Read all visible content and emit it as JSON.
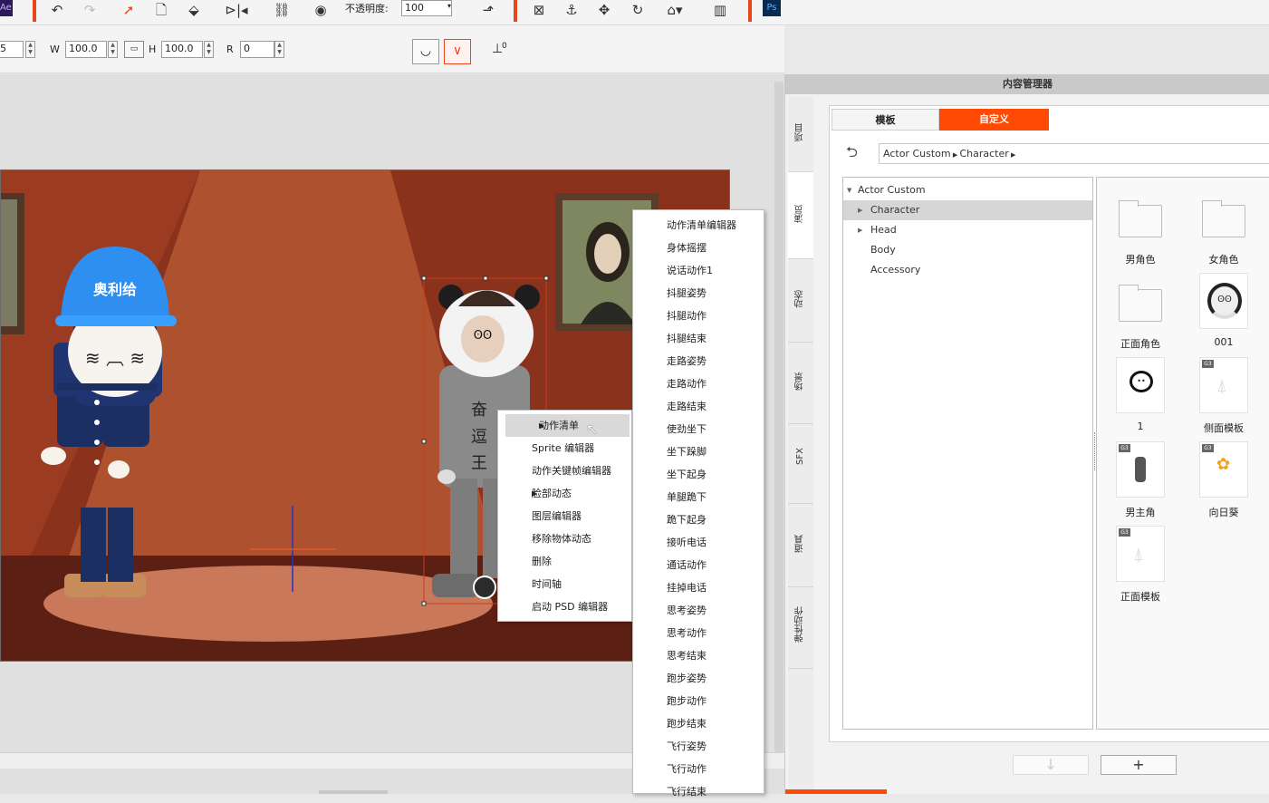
{
  "toolbar": {
    "opacity_label": "不透明度:",
    "opacity_value": "100",
    "ae_label": "Ae",
    "ps_label": "Ps"
  },
  "props": {
    "x_value": "5",
    "w_label": "W",
    "w_value": "100.0",
    "h_label": "H",
    "h_value": "100.0",
    "r_label": "R",
    "r_value": "0",
    "anchor_label": "0"
  },
  "scene": {
    "helmet_text": "奥利给",
    "shirt_text": [
      "奋",
      "逗",
      "王"
    ]
  },
  "context_menu": {
    "items": [
      {
        "label": "动作清单",
        "submenu": true
      },
      {
        "label": "Sprite 编辑器",
        "submenu": false
      },
      {
        "label": "动作关键帧编辑器",
        "submenu": false
      },
      {
        "label": "脸部动态",
        "submenu": true
      },
      {
        "label": "图层编辑器",
        "submenu": false
      },
      {
        "label": "移除物体动态",
        "submenu": false
      },
      {
        "label": "删除",
        "submenu": false
      },
      {
        "label": "时间轴",
        "submenu": false
      },
      {
        "label": "启动 PSD 编辑器",
        "submenu": false
      }
    ]
  },
  "submenu": {
    "items": [
      "动作清单编辑器",
      "身体摇摆",
      "说话动作1",
      "抖腿姿势",
      "抖腿动作",
      "抖腿结束",
      "走路姿势",
      "走路动作",
      "走路结束",
      "使劲坐下",
      "坐下跺脚",
      "坐下起身",
      "单腿跪下",
      "跪下起身",
      "接听电话",
      "通话动作",
      "挂掉电话",
      "思考姿势",
      "思考动作",
      "思考结束",
      "跑步姿势",
      "跑步动作",
      "跑步结束",
      "飞行姿势",
      "飞行动作",
      "飞行结束"
    ]
  },
  "content_manager": {
    "title": "内容管理器",
    "side_tabs": [
      "项目",
      "演员",
      "动态",
      "场景",
      "SFX",
      "道具",
      "弹性动作"
    ],
    "tabs": {
      "template": "模板",
      "custom": "自定义"
    },
    "back_icon": "return-arrow-icon",
    "breadcrumb": [
      "Actor Custom",
      "Character"
    ],
    "tree": [
      {
        "label": "Actor Custom",
        "expander": "▼"
      },
      {
        "label": "Character",
        "expander": "▶"
      },
      {
        "label": "Head",
        "expander": "▶"
      },
      {
        "label": "Body",
        "expander": ""
      },
      {
        "label": "Accessory",
        "expander": ""
      }
    ],
    "tiles": [
      "男角色",
      "女角色",
      "正面角色",
      "001",
      "1",
      "侧面模板",
      "男主角",
      "向日葵",
      "正面模板"
    ],
    "g3_badge": "G3",
    "add_button": "+",
    "down_button": "↓"
  },
  "colors": {
    "accent": "#ff4a06",
    "scene_bg": "#8b321c",
    "helmet": "#2f8ff0",
    "uniform": "#1c2f63"
  }
}
